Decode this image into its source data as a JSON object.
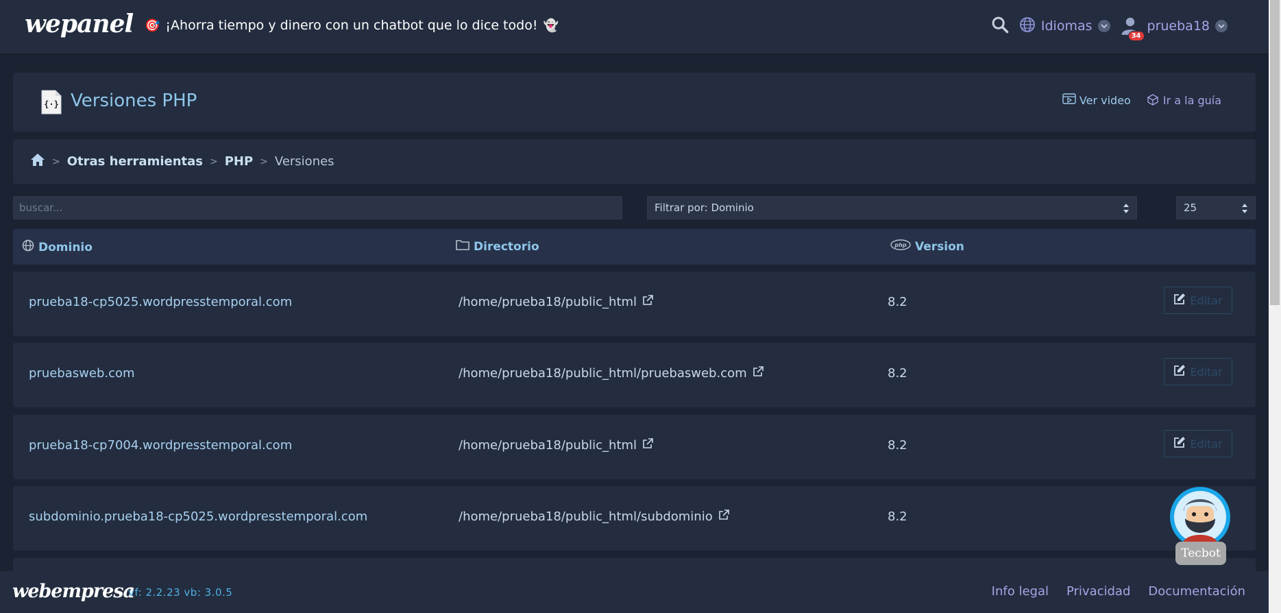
{
  "topbar": {
    "logo": "wepanel",
    "promo_text": "¡Ahorra tiempo y dinero con un chatbot que lo dice todo!",
    "languages_label": "Idiomas",
    "username": "prueba18",
    "notifications_count": "34"
  },
  "header": {
    "title": "Versiones PHP",
    "video_link": "Ver video",
    "guide_link": "Ir a la guía"
  },
  "breadcrumb": {
    "items": [
      "Otras herramientas",
      "PHP"
    ],
    "current": "Versiones"
  },
  "filters": {
    "search_placeholder": "buscar...",
    "filter_label": "Filtrar por: Dominio",
    "per_page": "25"
  },
  "table": {
    "headers": {
      "domain": "Dominio",
      "directory": "Directorio",
      "version": "Version"
    },
    "edit_label": "Editar",
    "rows": [
      {
        "domain": "prueba18-cp5025.wordpresstemporal.com",
        "directory": "/home/prueba18/public_html",
        "version": "8.2"
      },
      {
        "domain": "pruebasweb.com",
        "directory": "/home/prueba18/public_html/pruebasweb.com",
        "version": "8.2"
      },
      {
        "domain": "prueba18-cp7004.wordpresstemporal.com",
        "directory": "/home/prueba18/public_html",
        "version": "8.2"
      },
      {
        "domain": "subdominio.prueba18-cp5025.wordpresstemporal.com",
        "directory": "/home/prueba18/public_html/subdominio",
        "version": "8.2"
      }
    ]
  },
  "footer": {
    "logo": "webempresa",
    "version_text": "vf: 2.2.23 vb: 3.0.5",
    "links": [
      "Info legal",
      "Privacidad",
      "Documentación"
    ]
  },
  "chatbot": {
    "label": "Tecbot"
  },
  "colors": {
    "background": "#1b2332",
    "card": "#232d3f",
    "accent_blue": "#8fc6ea",
    "accent_purple": "#a9a3e5"
  }
}
